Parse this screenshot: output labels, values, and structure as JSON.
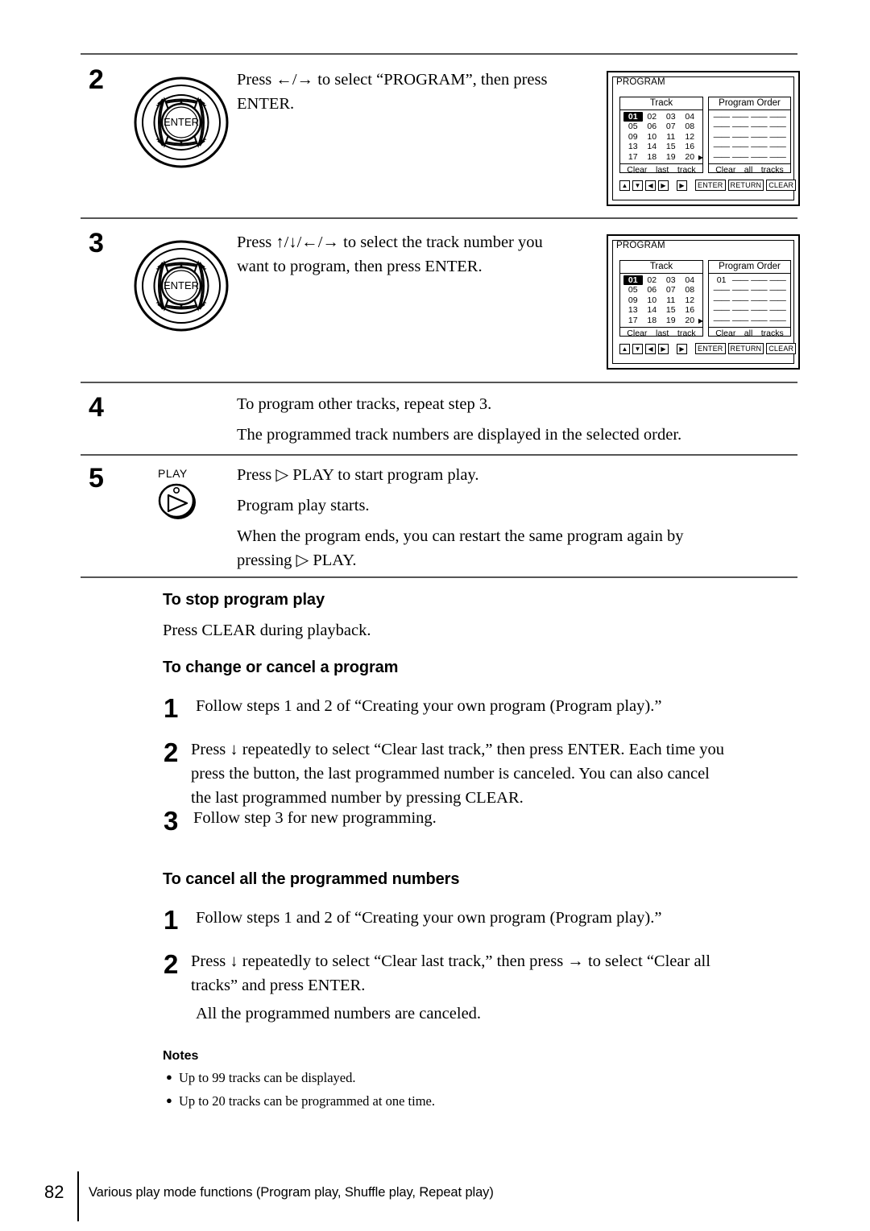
{
  "document": {
    "page_number": "82",
    "footer_text": "Various play mode functions (Program play, Shuffle play, Repeat play)"
  },
  "steps": [
    {
      "number": "2",
      "control_icon": "dpad-enter-icon",
      "lines": [
        "Press ←/→ to select “PROGRAM”, then press",
        "ENTER."
      ]
    },
    {
      "number": "3",
      "control_icon": "dpad-enter-icon",
      "lines": [
        "Press ↑/↓/←/→ to select the track number you",
        "want to program, then press ENTER."
      ]
    },
    {
      "number": "4",
      "control_icon": "",
      "lines": [
        "To program other tracks, repeat step 3.",
        "The programmed track numbers are displayed in the selected order."
      ]
    },
    {
      "number": "5",
      "control_icon": "play-button-icon",
      "control_label": "PLAY",
      "lines": [
        "Press ▷ PLAY to start program play.",
        "Program play starts.",
        "When the program ends, you can restart the same program again by",
        "pressing ▷ PLAY."
      ]
    }
  ],
  "osd_screens": [
    {
      "title": "PROGRAM",
      "track_panel": {
        "header": "Track",
        "cells": [
          "01",
          "02",
          "03",
          "04",
          "05",
          "06",
          "07",
          "08",
          "09",
          "10",
          "11",
          "12",
          "13",
          "14",
          "15",
          "16",
          "17",
          "18",
          "19",
          "20"
        ],
        "selected_cell": "01",
        "footer": [
          "Clear",
          "last",
          "track"
        ]
      },
      "order_panel": {
        "header": "Program Order",
        "cells": [
          "——",
          "——",
          "——",
          "——",
          "——",
          "——",
          "——",
          "——",
          "——",
          "——",
          "——",
          "——",
          "——",
          "——",
          "——",
          "——",
          "——",
          "——",
          "——",
          "——"
        ],
        "footer": [
          "Clear",
          "all",
          "tracks"
        ]
      },
      "keys": {
        "arrows": [
          "▲",
          "▼",
          "◀",
          "▶"
        ],
        "play": "▶",
        "words": [
          "ENTER",
          "RETURN",
          "CLEAR"
        ]
      }
    },
    {
      "title": "PROGRAM",
      "track_panel": {
        "header": "Track",
        "cells": [
          "01",
          "02",
          "03",
          "04",
          "05",
          "06",
          "07",
          "08",
          "09",
          "10",
          "11",
          "12",
          "13",
          "14",
          "15",
          "16",
          "17",
          "18",
          "19",
          "20"
        ],
        "selected_cell": "01",
        "footer": [
          "Clear",
          "last",
          "track"
        ]
      },
      "order_panel": {
        "header": "Program Order",
        "cells": [
          "01",
          "——",
          "——",
          "——",
          "——",
          "——",
          "——",
          "——",
          "——",
          "——",
          "——",
          "——",
          "——",
          "——",
          "——",
          "——",
          "——",
          "——",
          "——",
          "——"
        ],
        "footer": [
          "Clear",
          "all",
          "tracks"
        ]
      },
      "keys": {
        "arrows": [
          "▲",
          "▼",
          "◀",
          "▶"
        ],
        "play": "▶",
        "words": [
          "ENTER",
          "RETURN",
          "CLEAR"
        ]
      }
    }
  ],
  "sections": [
    {
      "heading": "To stop program play",
      "body": "Press CLEAR during playback."
    },
    {
      "heading": "To change or cancel a program",
      "items": [
        {
          "number": "1",
          "lines": [
            "Follow steps 1 and 2 of “Creating your own program (Program play).”"
          ]
        },
        {
          "number": "2",
          "lines": [
            "Press ↓ repeatedly to select “Clear last track,” then press ENTER.  Each time you",
            "press the button, the last programmed number is canceled.  You can also cancel",
            "the last programmed number by pressing CLEAR."
          ]
        },
        {
          "number": "3",
          "lines": [
            "Follow step 3 for new programming."
          ]
        }
      ]
    },
    {
      "heading": "To cancel all the programmed numbers",
      "items": [
        {
          "number": "1",
          "lines": [
            "Follow steps 1 and 2 of “Creating your own program (Program play).”"
          ]
        },
        {
          "number": "2",
          "lines": [
            "Press ↓ repeatedly to select “Clear last track,” then press → to select “Clear all",
            "tracks” and press ENTER."
          ]
        }
      ],
      "trailing": "All the programmed numbers are canceled."
    }
  ],
  "notes": {
    "heading": "Notes",
    "items": [
      "Up to 99 tracks can be displayed.",
      "Up to 20 tracks can be programmed at one time."
    ]
  }
}
